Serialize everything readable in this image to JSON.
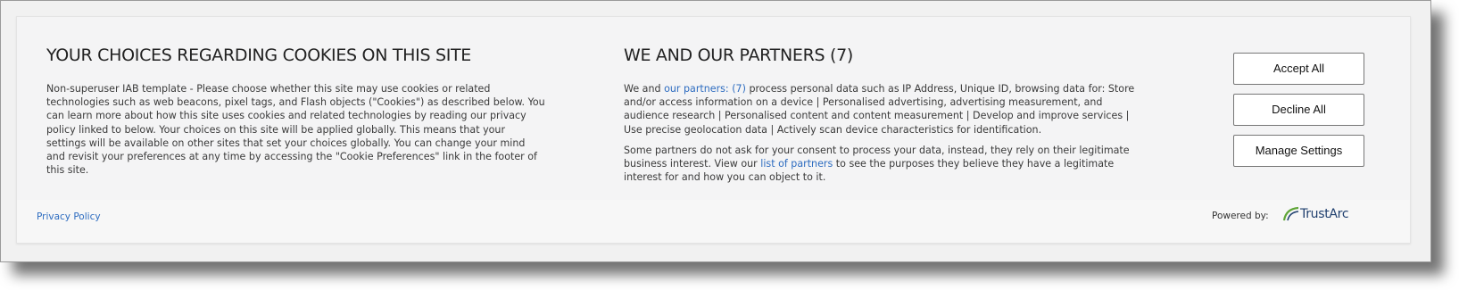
{
  "left": {
    "title": "YOUR CHOICES REGARDING COOKIES ON THIS SITE",
    "body": "Non-superuser IAB template - Please choose whether this site may use cookies or related technologies such as web beacons, pixel tags, and Flash objects (\"Cookies\") as described below. You can learn more about how this site uses cookies and related technologies by reading our privacy policy linked to below. Your choices on this site will be applied globally. This means that your settings will be available on other sites that set your choices globally. You can change your mind and revisit your preferences at any time by accessing the \"Cookie Preferences\" link in the footer of this site."
  },
  "partners": {
    "title": "WE AND OUR PARTNERS (7)",
    "p1_prefix": "We and ",
    "p1_link": "our partners: (7)",
    "p1_suffix": " process personal data such as IP Address, Unique ID, browsing data for: Store and/or access information on a device | Personalised advertising, advertising measurement, and audience research | Personalised content and content measurement | Develop and improve services | Use precise geolocation data | Actively scan device characteristics for identification.",
    "p2_prefix": "Some partners do not ask for your consent to process your data, instead, they rely on their legitimate business interest. View our ",
    "p2_link": "list of partners",
    "p2_suffix": " to see the purposes they believe they have a legitimate interest for and how you can object to it."
  },
  "buttons": {
    "accept": "Accept All",
    "decline": "Decline All",
    "manage": "Manage Settings"
  },
  "footer": {
    "privacy_link": "Privacy Policy",
    "powered_by": "Powered by:",
    "brand": "TrustArc",
    "brand_color": "#1f3f6e",
    "brand_accent": "#5fa537"
  }
}
